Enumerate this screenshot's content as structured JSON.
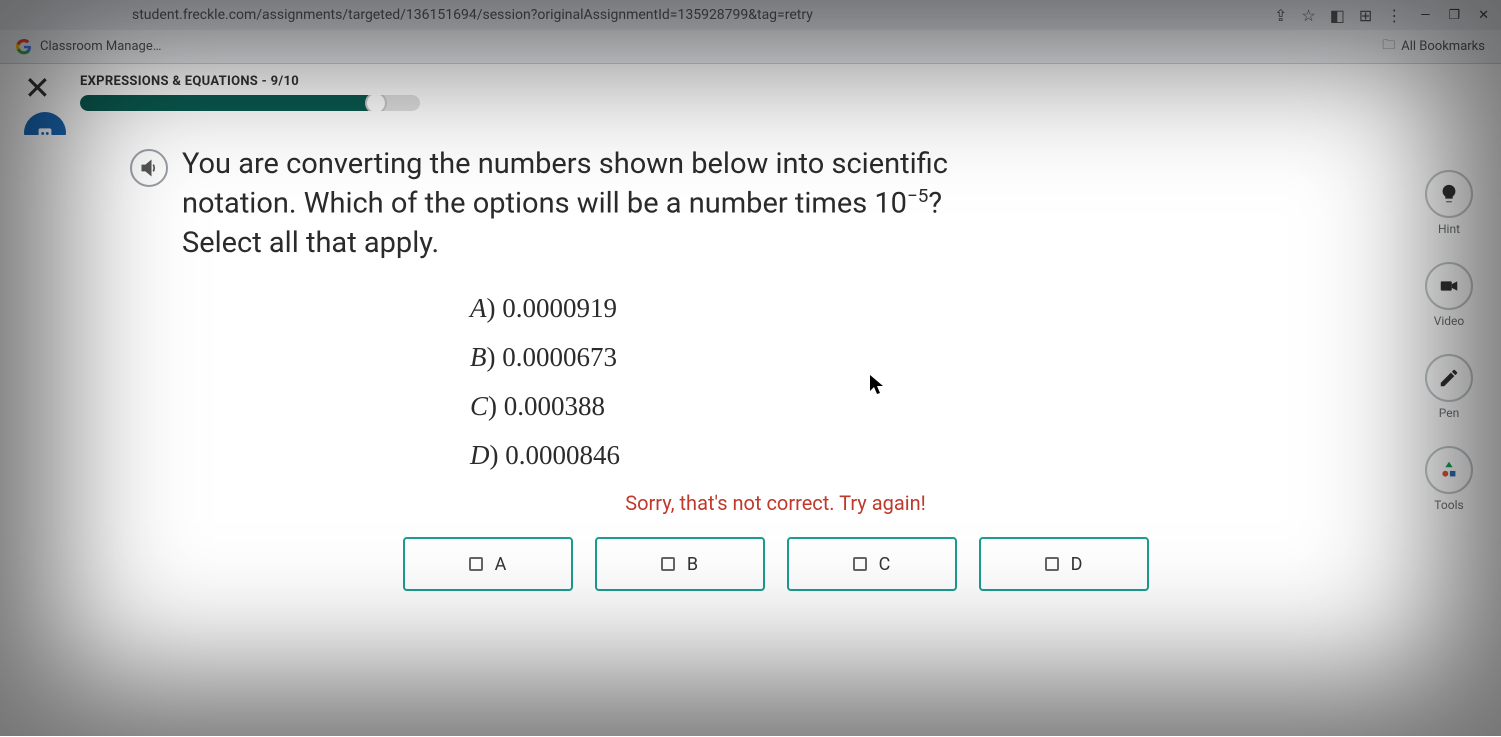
{
  "browser": {
    "url": "student.freckle.com/assignments/targeted/136151694/session?originalAssignmentId=135928799&tag=retry",
    "bookmark": "Classroom Manage…",
    "all_bookmarks": "All Bookmarks"
  },
  "header": {
    "topic": "EXPRESSIONS & EQUATIONS - 9/10"
  },
  "question": {
    "text_pre": "You are converting the numbers shown below into scientific notation. Which of the options will be a number times 10",
    "exponent": "−5",
    "text_post": "? Select all that apply."
  },
  "choices": {
    "a": {
      "letter": "A",
      "value": "0.0000919"
    },
    "b": {
      "letter": "B",
      "value": "0.0000673"
    },
    "c": {
      "letter": "C",
      "value": "0.000388"
    },
    "d": {
      "letter": "D",
      "value": "0.0000846"
    }
  },
  "feedback": "Sorry, that's not correct. Try again!",
  "answers": {
    "a": "A",
    "b": "B",
    "c": "C",
    "d": "D"
  },
  "tools": {
    "hint": "Hint",
    "video": "Video",
    "pen": "Pen",
    "tools": "Tools"
  }
}
